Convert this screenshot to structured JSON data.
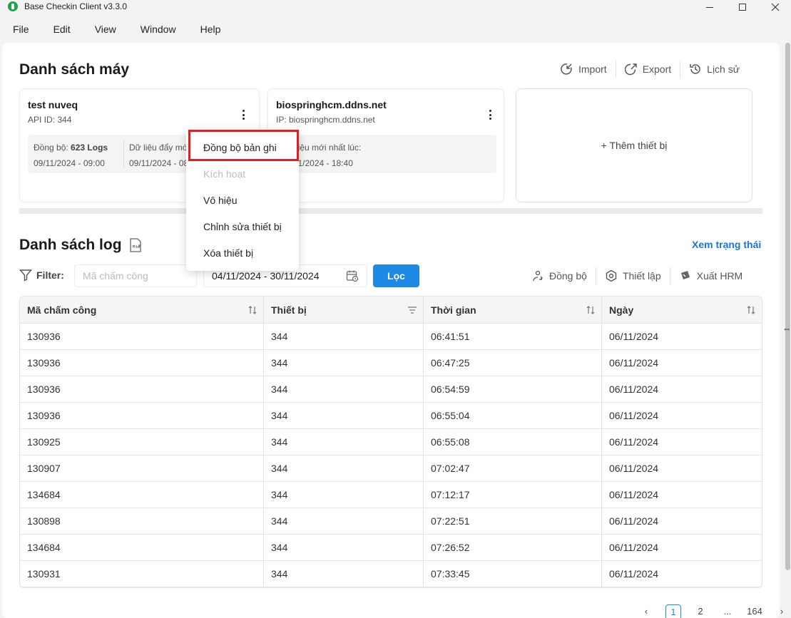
{
  "window": {
    "title": "Base Checkin Client v3.3.0"
  },
  "menu": [
    "File",
    "Edit",
    "View",
    "Window",
    "Help"
  ],
  "devices_section": {
    "title": "Danh sách máy",
    "actions": {
      "import": "Import",
      "export": "Export",
      "history": "Lịch sử"
    }
  },
  "devices": [
    {
      "name": "test nuveq",
      "sub": "API ID: 344",
      "sync_label": "Đồng bộ: ",
      "sync_count": "623 Logs",
      "sync_time": "09/11/2024 - 09:00",
      "latest_label": "Dữ liệu đẩy mới nhất lúc:",
      "latest_time": "09/11/2024 - 08:45"
    },
    {
      "name": "biospringhcm.ddns.net",
      "sub": "IP: biospringhcm.ddns.net",
      "latest_label": "Dữ liệu mới nhất lúc:",
      "latest_time": "09/11/2024 - 18:40"
    }
  ],
  "add_device": "+ Thêm thiết bị",
  "context_menu": {
    "items": [
      "Đồng bộ bản ghi",
      "Kích hoạt",
      "Vô hiệu",
      "Chỉnh sửa thiết bị",
      "Xóa thiết bị"
    ],
    "disabled": [
      false,
      true,
      false,
      false,
      false
    ]
  },
  "log_section": {
    "title": "Danh sách log",
    "status_link": "Xem trạng thái",
    "filter_label": "Filter:",
    "code_placeholder": "Mã chấm công",
    "date_range": "04/11/2024 - 30/11/2024",
    "filter_button": "Lọc",
    "actions": {
      "sync": "Đồng bộ",
      "settings": "Thiết lập",
      "export_hrm": "Xuất HRM"
    }
  },
  "table": {
    "columns": [
      "Mã chấm công",
      "Thiết bị",
      "Thời gian",
      "Ngày"
    ],
    "rows": [
      [
        "130936",
        "344",
        "06:41:51",
        "06/11/2024"
      ],
      [
        "130936",
        "344",
        "06:47:25",
        "06/11/2024"
      ],
      [
        "130936",
        "344",
        "06:54:59",
        "06/11/2024"
      ],
      [
        "130936",
        "344",
        "06:55:04",
        "06/11/2024"
      ],
      [
        "130925",
        "344",
        "06:55:08",
        "06/11/2024"
      ],
      [
        "130907",
        "344",
        "07:02:47",
        "06/11/2024"
      ],
      [
        "134684",
        "344",
        "07:12:17",
        "06/11/2024"
      ],
      [
        "130898",
        "344",
        "07:22:51",
        "06/11/2024"
      ],
      [
        "134684",
        "344",
        "07:26:52",
        "06/11/2024"
      ],
      [
        "130931",
        "344",
        "07:33:45",
        "06/11/2024"
      ]
    ]
  },
  "pagination": {
    "prev": "‹",
    "pages": [
      "1",
      "2",
      "...",
      "164"
    ],
    "next": "›",
    "current": "1"
  },
  "colors": {
    "accent": "#1e88e5",
    "highlight": "#e02020",
    "link": "#1976d2"
  }
}
